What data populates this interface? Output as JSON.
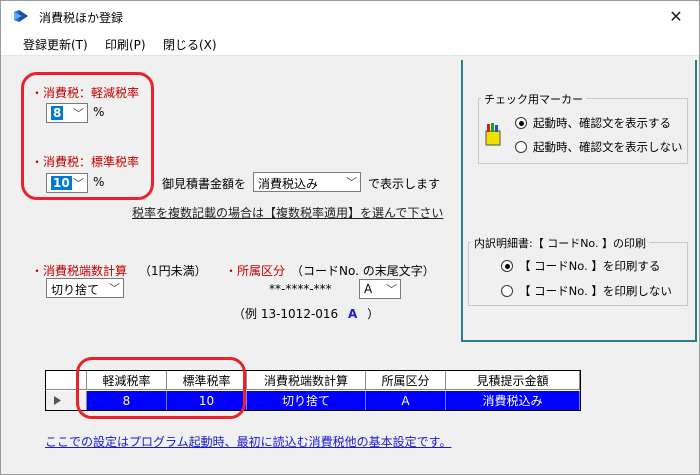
{
  "window": {
    "title": "消費税ほか登録",
    "close_glyph": "✕"
  },
  "menu": {
    "items": [
      "登録更新(T)",
      "印刷(P)",
      "閉じる(X)"
    ]
  },
  "tax": {
    "reduced_label": "・消費税：軽減税率",
    "reduced_value": "8",
    "standard_label": "・消費税：標準税率",
    "standard_value": "10",
    "percent": "%"
  },
  "estimate": {
    "prefix": "御見積書金額を",
    "value": "消費税込み",
    "suffix": "で表示します",
    "note": "税率を複数記載の場合は【複数税率適用】を選んで下さい"
  },
  "rounding": {
    "label": "・消費税端数計算",
    "sub": "（1円未満）",
    "value": "切り捨て"
  },
  "division": {
    "label": "・所属区分",
    "sub": "（コードNo. の末尾文字）",
    "pattern": "**-****-***",
    "value": "A",
    "example_prefix": "（例  13-1012-016",
    "example_hl": "A",
    "example_suffix": "）"
  },
  "check_marker": {
    "title": "チェック用マーカー",
    "opt1": "起動時、確認文を表示する",
    "opt2": "起動時、確認文を表示しない"
  },
  "details_print": {
    "title": "内訳明細書:【 コードNo. 】の印刷",
    "opt1": "【 コードNo. 】を印刷する",
    "opt2": "【 コードNo. 】を印刷しない"
  },
  "grid": {
    "columns": [
      "軽減税率",
      "標準税率",
      "消費税端数計算",
      "所属区分",
      "見積提示金額"
    ],
    "row": [
      "8",
      "10",
      "切り捨て",
      "A",
      "消費税込み"
    ]
  },
  "footer_note": "ここでの設定はプログラム起動時、最初に読込む消費税他の基本設定です。",
  "colors": {
    "accent_red": "#e8232a",
    "label_red": "#c00000",
    "grid_select": "#0000ff",
    "divider": "#2a7f86",
    "link": "#1a1acc"
  }
}
